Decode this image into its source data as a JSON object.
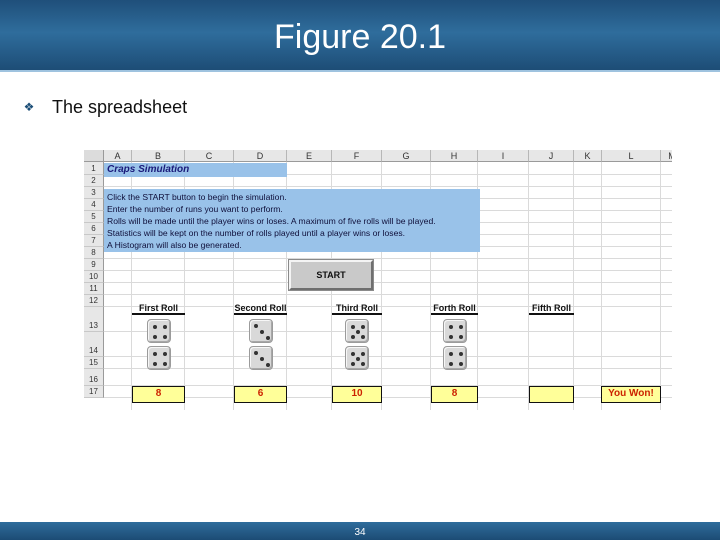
{
  "slide": {
    "title": "Figure 20.1",
    "bullet": "The spreadsheet",
    "page_number": "34"
  },
  "sheet": {
    "columns": [
      "A",
      "B",
      "C",
      "D",
      "E",
      "F",
      "G",
      "H",
      "I",
      "J",
      "K",
      "L",
      "M"
    ],
    "rows": [
      "1",
      "2",
      "3",
      "4",
      "5",
      "6",
      "7",
      "8",
      "9",
      "10",
      "11",
      "12",
      "13",
      "14",
      "15",
      "16",
      "17"
    ],
    "title": "Craps Simulation",
    "instructions": [
      "Click the START button to begin the simulation.",
      "Enter the number of runs you want to perform.",
      "Rolls will be made until the player wins or loses.  A maximum of five rolls will be played.",
      "Statistics will be kept on the number of rolls played until a player wins or loses.",
      "A Histogram will also be generated."
    ],
    "start_button": "START",
    "roll_labels": [
      "First Roll",
      "Second Roll",
      "Third Roll",
      "Forth Roll",
      "Fifth Roll"
    ],
    "dice": [
      {
        "die1": 4,
        "die2": 4
      },
      {
        "die1": 3,
        "die2": 3
      },
      {
        "die1": 5,
        "die2": 5
      },
      {
        "die1": 4,
        "die2": 4
      }
    ],
    "totals": [
      "8",
      "6",
      "10",
      "8",
      ""
    ],
    "result": "You Won!"
  },
  "colors": {
    "title_bar": "#2f6d9c",
    "info_fill": "#99c2e9",
    "result_fill": "#ffff99",
    "result_text": "#cc2200"
  }
}
